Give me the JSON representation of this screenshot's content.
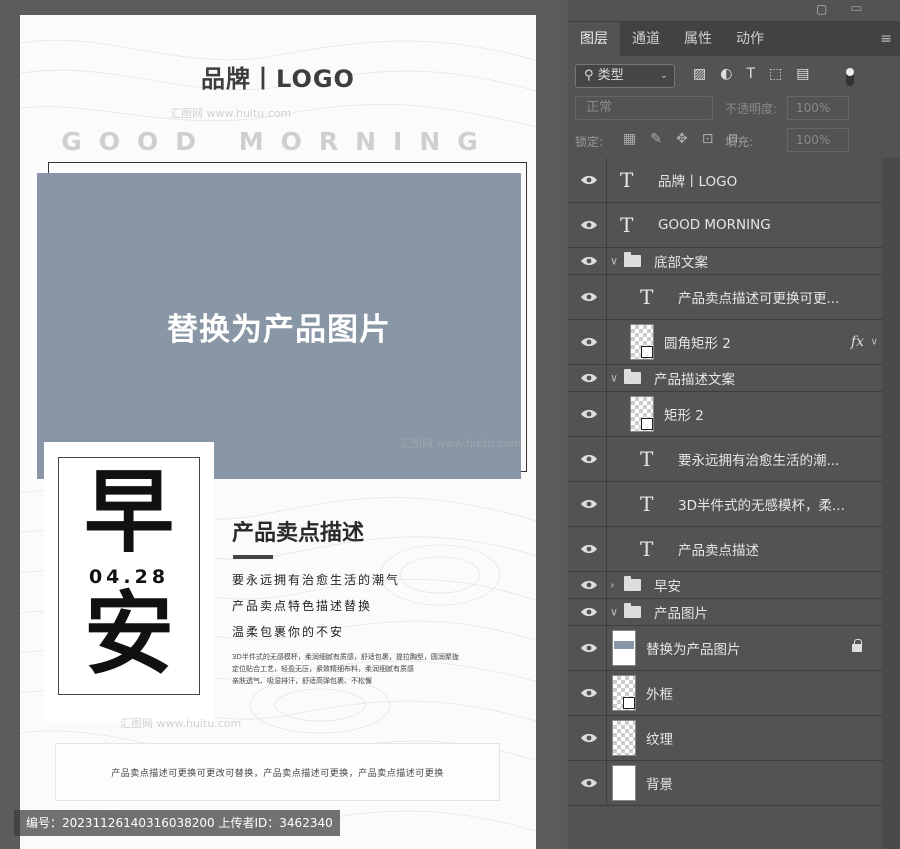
{
  "canvas": {
    "brand": "品牌丨LOGO",
    "greeting": "GOOD MORNING",
    "photo_placeholder": "替换为产品图片",
    "zao_char": "早",
    "date": "04.28",
    "an_char": "安",
    "sell_title": "产品卖点描述",
    "sell_lines": [
      "要永远拥有治愈生活的潮气",
      "产品卖点特色描述替换",
      "温柔包裹你的不安"
    ],
    "small_lines": [
      "3D半件式的无感模杯，柔润细腻有质感，舒适包裹，提拉胸型，圆润聚拢",
      "定位贴合工艺，轻盈无压，紧致精细布料，柔润细腻有质感",
      "亲肤透气、吸湿排汗，舒适高弹包裹、不松懈"
    ],
    "bottom_text": "产品卖点描述可更换可更改可替换，产品卖点描述可更换，产品卖点描述可更换",
    "watermark": "汇图网 www.huitu.com",
    "id_strip": "编号：20231126140316038200  上传者ID：3462340"
  },
  "panel": {
    "tabs": [
      "图层",
      "通道",
      "属性",
      "动作"
    ],
    "filter": "类型",
    "blend_mode": "正常",
    "opacity_label": "不透明度:",
    "opacity_value": "100%",
    "lock_label": "锁定:",
    "fill_label": "填充:",
    "fill_value": "100%",
    "fx": "fx",
    "layers": [
      {
        "name": "品牌丨LOGO"
      },
      {
        "name": "GOOD MORNING"
      },
      {
        "name": "底部文案"
      },
      {
        "name": "产品卖点描述可更换可更..."
      },
      {
        "name": "圆角矩形 2"
      },
      {
        "name": "产品描述文案"
      },
      {
        "name": "矩形 2"
      },
      {
        "name": "要永远拥有治愈生活的潮..."
      },
      {
        "name": "3D半件式的无感模杯，柔..."
      },
      {
        "name": "产品卖点描述"
      },
      {
        "name": "早安"
      },
      {
        "name": "产品图片"
      },
      {
        "name": "替换为产品图片"
      },
      {
        "name": "外框"
      },
      {
        "name": "纹理"
      },
      {
        "name": "背景"
      }
    ]
  }
}
